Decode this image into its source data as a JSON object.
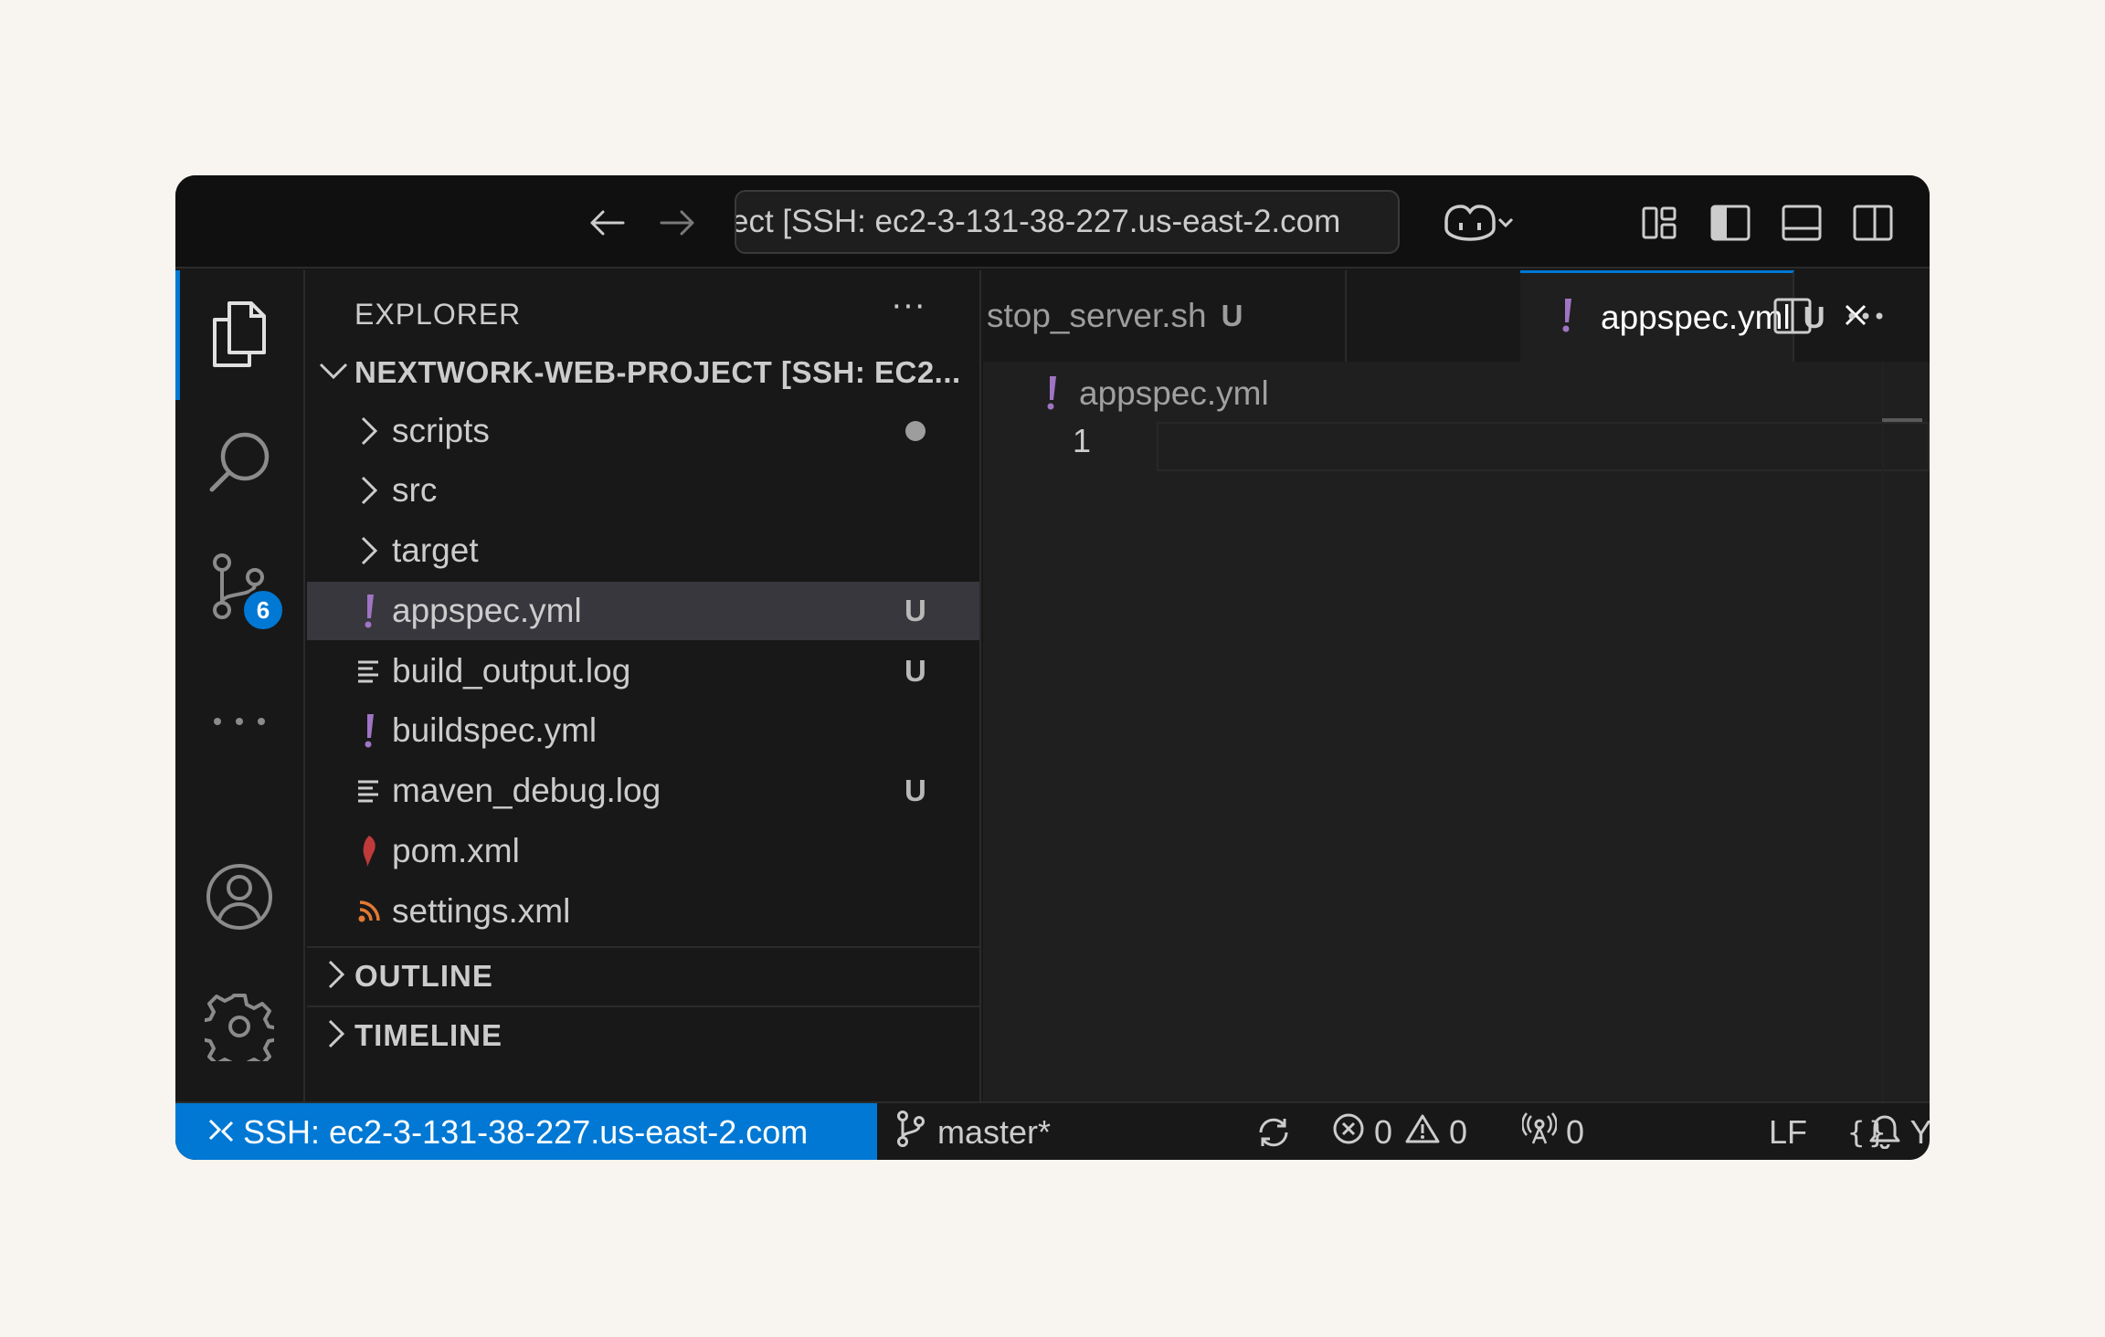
{
  "titlebar": {
    "search_text": "ect [SSH: ec2-3-131-38-227.us-east-2.com"
  },
  "activity": {
    "scm_badge": "6"
  },
  "sidebar": {
    "title": "EXPLORER",
    "more": "···",
    "project": "NEXTWORK-WEB-PROJECT [SSH: EC2...",
    "items": [
      {
        "label": "scripts",
        "icon": "chevron-right-icon",
        "badge": "",
        "dot": true
      },
      {
        "label": "src",
        "icon": "chevron-right-icon",
        "badge": ""
      },
      {
        "label": "target",
        "icon": "chevron-right-icon",
        "badge": ""
      },
      {
        "label": "appspec.yml",
        "icon": "yaml-icon",
        "badge": "U",
        "selected": true
      },
      {
        "label": "build_output.log",
        "icon": "log-file-icon",
        "badge": "U"
      },
      {
        "label": "buildspec.yml",
        "icon": "yaml-icon",
        "badge": ""
      },
      {
        "label": "maven_debug.log",
        "icon": "log-file-icon",
        "badge": "U"
      },
      {
        "label": "pom.xml",
        "icon": "maven-icon",
        "badge": ""
      },
      {
        "label": "settings.xml",
        "icon": "rss-xml-icon",
        "badge": ""
      }
    ],
    "sections": [
      "OUTLINE",
      "TIMELINE"
    ]
  },
  "tabs": [
    {
      "label": "stop_server.sh",
      "badge": "U",
      "active": false
    },
    {
      "label": "appspec.yml",
      "badge": "U",
      "active": true
    }
  ],
  "editor": {
    "breadcrumb": "appspec.yml",
    "line_number": "1"
  },
  "statusbar": {
    "remote": "SSH: ec2-3-131-38-227.us-east-2.com",
    "branch": "master*",
    "errors": "0",
    "warnings": "0",
    "ports": "0",
    "eol": "LF",
    "language": "YAML"
  },
  "colors": {
    "accent": "#0078d4",
    "yaml": "#a074c4",
    "maven": "#c0393b",
    "rss": "#e37933"
  }
}
